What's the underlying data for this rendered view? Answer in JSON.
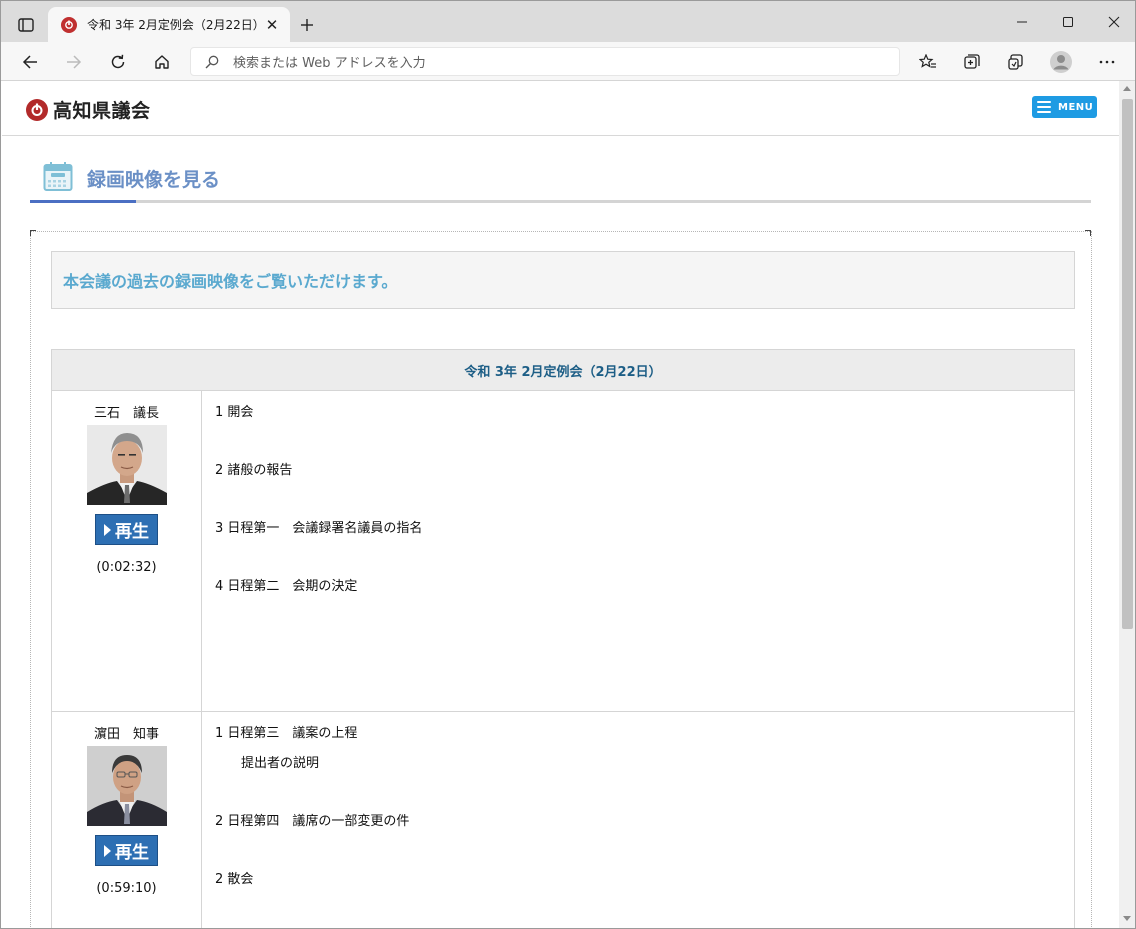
{
  "browser": {
    "tab_title": "令和 3年 2月定例会（2月22日）",
    "tab_close": "✕",
    "new_tab": "+",
    "address_placeholder": "検索または Web アドレスを入力"
  },
  "site": {
    "logo_text": "高知県議会",
    "menu_label": "MENU",
    "brand_color": "#b22a2a",
    "menu_color": "#1e9be3"
  },
  "section": {
    "heading": "録画映像を見る",
    "intro": "本会議の過去の録画映像をご覧いただけます。",
    "heading_color": "#6b90c6",
    "intro_color": "#5aa9cf"
  },
  "session": {
    "title": "令和 3年 2月定例会（2月22日）",
    "rows": [
      {
        "speaker": "三石　議長",
        "play_label": "再生",
        "duration": "(0:02:32)",
        "agenda": [
          {
            "text": "1 開会"
          },
          {
            "text": "2 諸般の報告"
          },
          {
            "text": "3 日程第一　会議録署名議員の指名"
          },
          {
            "text": "4 日程第二　会期の決定"
          }
        ]
      },
      {
        "speaker": "濵田　知事",
        "play_label": "再生",
        "duration": "(0:59:10)",
        "agenda": [
          {
            "text": "1 日程第三　議案の上程",
            "sub": "提出者の説明"
          },
          {
            "text": "2 日程第四　議席の一部変更の件"
          },
          {
            "text": "2 散会"
          }
        ]
      }
    ]
  }
}
